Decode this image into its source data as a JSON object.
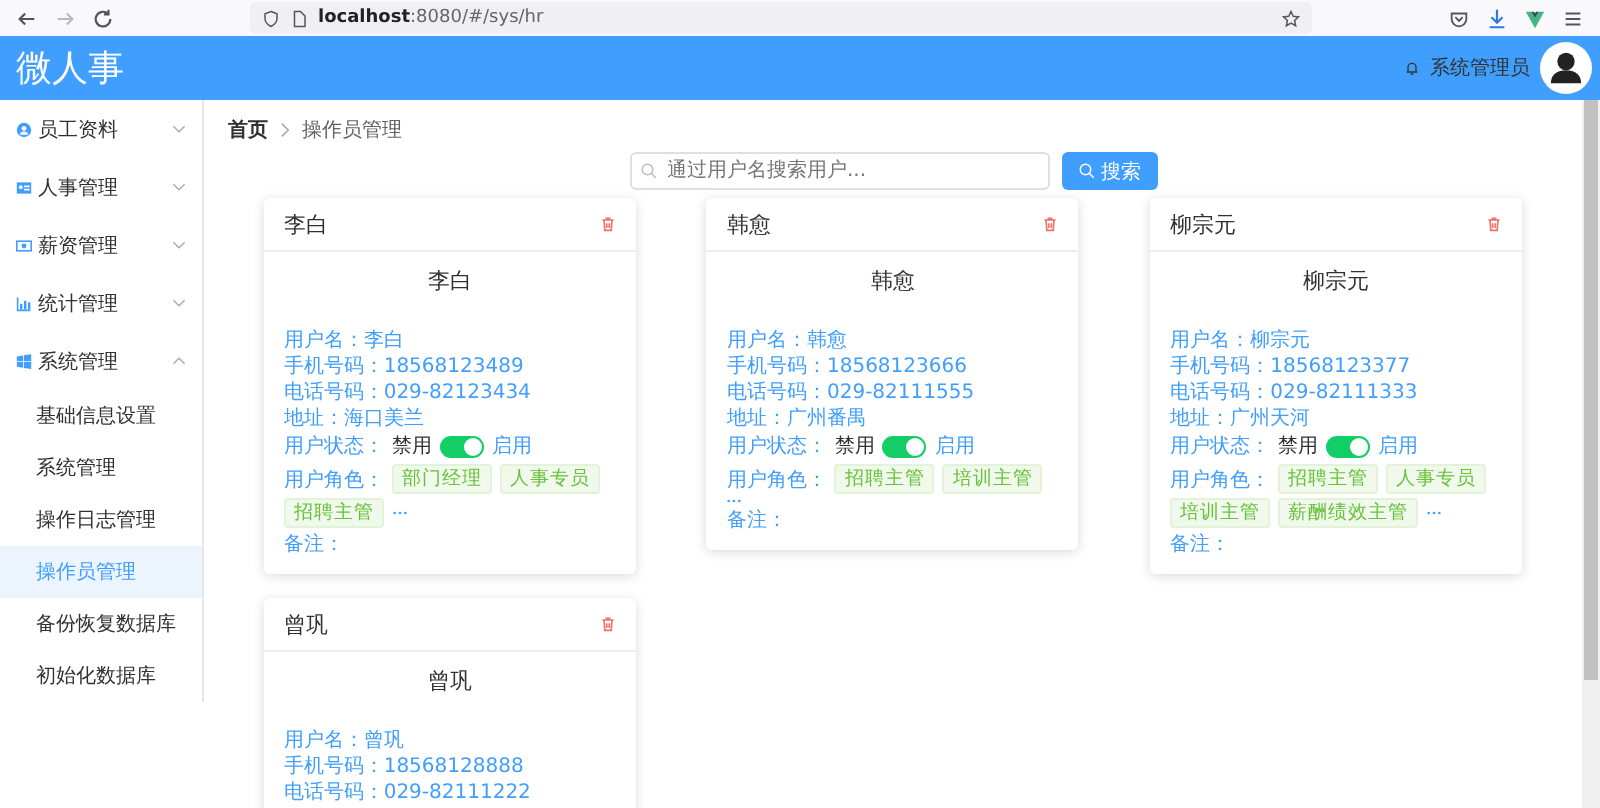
{
  "browser": {
    "url_host": "localhost",
    "url_rest": ":8080/#/sys/hr"
  },
  "header": {
    "logo": "微人事",
    "user_name": "系统管理员"
  },
  "sidebar": {
    "items": [
      {
        "label": "员工资料",
        "expanded": false
      },
      {
        "label": "人事管理",
        "expanded": false
      },
      {
        "label": "薪资管理",
        "expanded": false
      },
      {
        "label": "统计管理",
        "expanded": false
      },
      {
        "label": "系统管理",
        "expanded": true,
        "children": [
          {
            "label": "基础信息设置",
            "selected": false
          },
          {
            "label": "系统管理",
            "selected": false
          },
          {
            "label": "操作日志管理",
            "selected": false
          },
          {
            "label": "操作员管理",
            "selected": true
          },
          {
            "label": "备份恢复数据库",
            "selected": false
          },
          {
            "label": "初始化数据库",
            "selected": false
          }
        ]
      }
    ]
  },
  "breadcrumb": [
    "首页",
    "操作员管理"
  ],
  "search": {
    "placeholder": "通过用户名搜索用户...",
    "button": "搜索"
  },
  "cards": [
    {
      "title": "李白",
      "name": "李白",
      "fields": [
        {
          "label": "用户名：",
          "value": "李白"
        },
        {
          "label": "手机号码：",
          "value": "18568123489"
        },
        {
          "label": "电话号码：",
          "value": "029-82123434"
        },
        {
          "label": "地址：",
          "value": "海口美兰"
        }
      ],
      "status_label": "用户状态：",
      "off_label": "禁用",
      "on_label": "启用",
      "enabled": true,
      "roles_label": "用户角色：",
      "roles": [
        "部门经理",
        "人事专员",
        "招聘主管"
      ],
      "remark_label": "备注："
    },
    {
      "title": "韩愈",
      "name": "韩愈",
      "fields": [
        {
          "label": "用户名：",
          "value": "韩愈"
        },
        {
          "label": "手机号码：",
          "value": "18568123666"
        },
        {
          "label": "电话号码：",
          "value": "029-82111555"
        },
        {
          "label": "地址：",
          "value": "广州番禺"
        }
      ],
      "status_label": "用户状态：",
      "off_label": "禁用",
      "on_label": "启用",
      "enabled": true,
      "roles_label": "用户角色：",
      "roles": [
        "招聘主管",
        "培训主管"
      ],
      "remark_label": "备注："
    },
    {
      "title": "柳宗元",
      "name": "柳宗元",
      "fields": [
        {
          "label": "用户名：",
          "value": "柳宗元"
        },
        {
          "label": "手机号码：",
          "value": "18568123377"
        },
        {
          "label": "电话号码：",
          "value": "029-82111333"
        },
        {
          "label": "地址：",
          "value": "广州天河"
        }
      ],
      "status_label": "用户状态：",
      "off_label": "禁用",
      "on_label": "启用",
      "enabled": true,
      "roles_label": "用户角色：",
      "roles": [
        "招聘主管",
        "人事专员",
        "培训主管",
        "薪酬绩效主管"
      ],
      "remark_label": "备注："
    },
    {
      "title": "曾巩",
      "name": "曾巩",
      "fields": [
        {
          "label": "用户名：",
          "value": "曾巩"
        },
        {
          "label": "手机号码：",
          "value": "18568128888"
        },
        {
          "label": "电话号码：",
          "value": "029-82111222"
        }
      ]
    }
  ]
}
